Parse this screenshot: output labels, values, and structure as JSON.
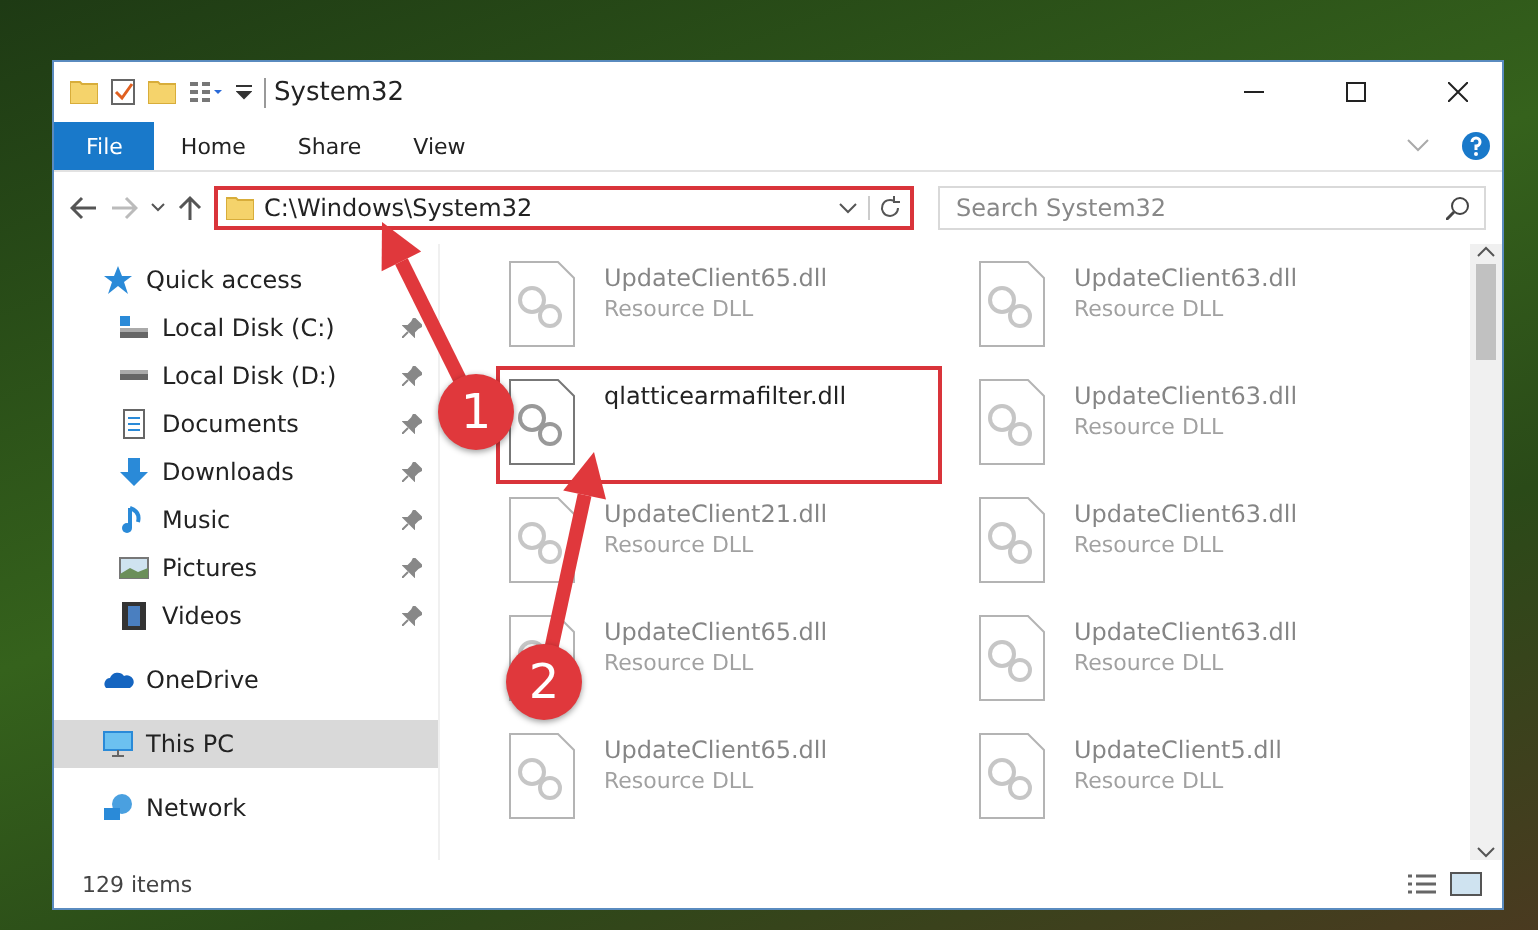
{
  "window": {
    "title": "System32"
  },
  "ribbon_tabs": [
    {
      "label": "File",
      "selected": true
    },
    {
      "label": "Home",
      "selected": false
    },
    {
      "label": "Share",
      "selected": false
    },
    {
      "label": "View",
      "selected": false
    }
  ],
  "address_bar": {
    "path": "C:\\Windows\\System32",
    "highlighted": true
  },
  "search": {
    "placeholder": "Search System32"
  },
  "sidebar": {
    "items": [
      {
        "label": "Quick access",
        "kind": "quick",
        "selected": false,
        "children": [
          {
            "label": "Local Disk (C:)",
            "kind": "disk-c",
            "pinned": true
          },
          {
            "label": "Local Disk (D:)",
            "kind": "disk",
            "pinned": true
          },
          {
            "label": "Documents",
            "kind": "documents",
            "pinned": true
          },
          {
            "label": "Downloads",
            "kind": "downloads",
            "pinned": true
          },
          {
            "label": "Music",
            "kind": "music",
            "pinned": true
          },
          {
            "label": "Pictures",
            "kind": "pictures",
            "pinned": true
          },
          {
            "label": "Videos",
            "kind": "videos",
            "pinned": true
          }
        ]
      },
      {
        "label": "OneDrive",
        "kind": "cloud",
        "selected": false
      },
      {
        "label": "This PC",
        "kind": "pc",
        "selected": true
      },
      {
        "label": "Network",
        "kind": "network",
        "selected": false
      }
    ]
  },
  "files": [
    {
      "name": "UpdateClient65.dll",
      "type": "Resource DLL",
      "faded": true,
      "highlighted": false
    },
    {
      "name": "UpdateClient63.dll",
      "type": "Resource DLL",
      "faded": true,
      "highlighted": false
    },
    {
      "name": "qlatticearmafilter.dll",
      "faded": false,
      "highlighted": true
    },
    {
      "name": "UpdateClient63.dll",
      "type": "Resource DLL",
      "faded": true,
      "highlighted": false
    },
    {
      "name": "UpdateClient21.dll",
      "type": "Resource DLL",
      "faded": true,
      "highlighted": false
    },
    {
      "name": "UpdateClient63.dll",
      "type": "Resource DLL",
      "faded": true,
      "highlighted": false
    },
    {
      "name": "UpdateClient65.dll",
      "type": "Resource DLL",
      "faded": true,
      "highlighted": false
    },
    {
      "name": "UpdateClient63.dll",
      "type": "Resource DLL",
      "faded": true,
      "highlighted": false
    },
    {
      "name": "UpdateClient65.dll",
      "type": "Resource DLL",
      "faded": true,
      "highlighted": false
    },
    {
      "name": "UpdateClient5.dll",
      "type": "Resource DLL",
      "faded": true,
      "highlighted": false
    }
  ],
  "status_bar": {
    "item_count": "129 items"
  },
  "callouts": [
    {
      "number": "1"
    },
    {
      "number": "2"
    }
  ]
}
